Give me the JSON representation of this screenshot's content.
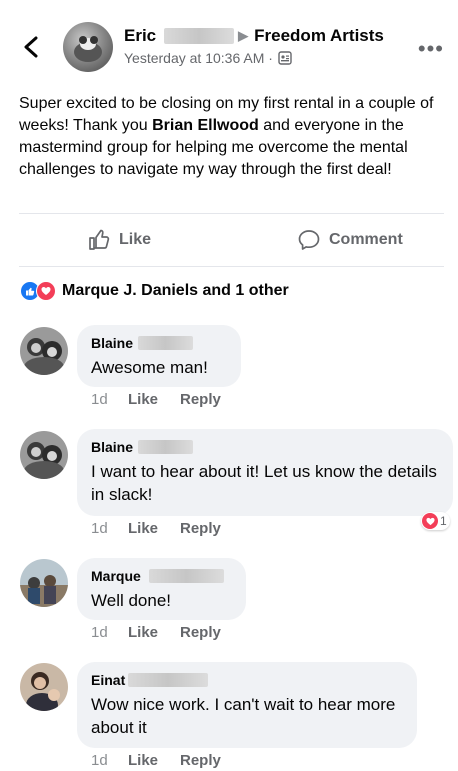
{
  "header": {
    "author_first": "Eric",
    "arrow": "▶",
    "group": "Freedom Artists",
    "time": "Yesterday at 10:36 AM ·",
    "more": "•••"
  },
  "post": {
    "text_before": "Super excited to be closing on my first rental in a couple of weeks! Thank you ",
    "mention": "Brian Ellwood",
    "text_after": " and everyone in the mastermind group for helping me overcome the mental challenges to navigate my way through the first deal!"
  },
  "actions": {
    "like": "Like",
    "comment": "Comment"
  },
  "reactions": {
    "summary": "Marque J. Daniels and 1 other"
  },
  "comments": [
    {
      "name": "Blaine",
      "text": "Awesome man!",
      "time": "1d",
      "like": "Like",
      "reply": "Reply"
    },
    {
      "name": "Blaine",
      "text": "I want to hear about it! Let us know the details in slack!",
      "time": "1d",
      "like": "Like",
      "reply": "Reply",
      "reaction_count": "1"
    },
    {
      "name": "Marque",
      "text": "Well done!",
      "time": "1d",
      "like": "Like",
      "reply": "Reply"
    },
    {
      "name": "Einat",
      "text": "Wow nice work. I can't wait to hear more about it",
      "time": "1d",
      "like": "Like",
      "reply": "Reply"
    }
  ],
  "colors": {
    "like_blue": "#1877f2",
    "love_red": "#f33e58",
    "bubble": "#f0f2f5",
    "meta_gray": "#65676b"
  }
}
